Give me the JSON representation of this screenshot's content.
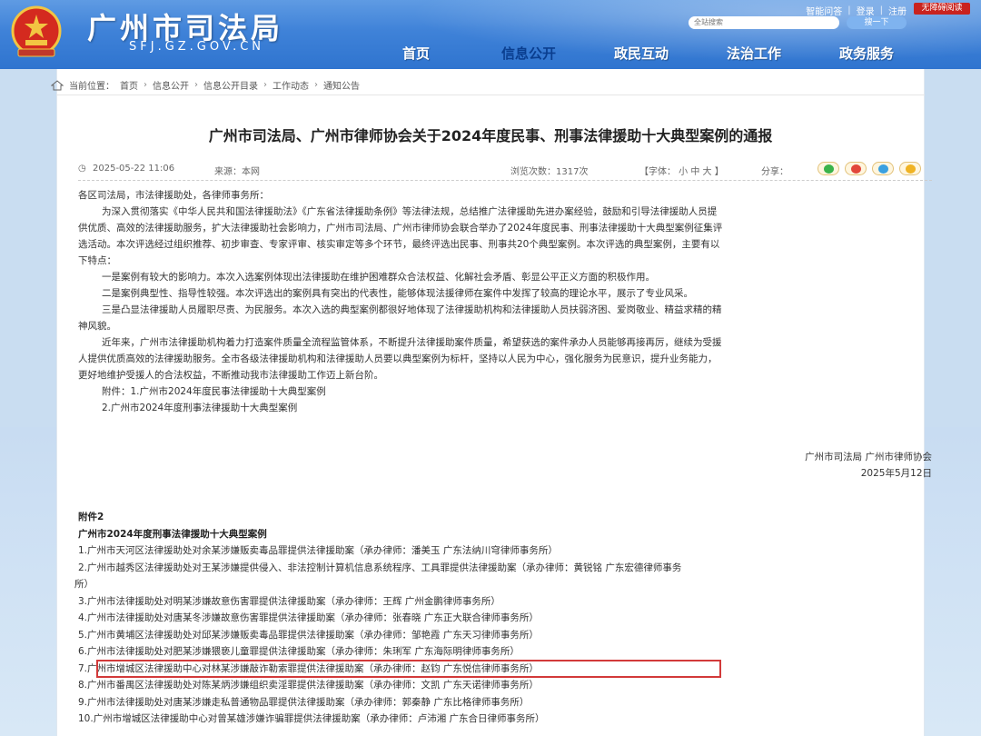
{
  "header": {
    "site_name": "广州市司法局",
    "site_domain": "SFJ.GZ.GOV.CN",
    "toplinks": [
      "智能问答",
      "登录",
      "注册"
    ],
    "a11y_label": "无障碍阅读",
    "search_placeholder": "全站搜索",
    "search_button": "搜一下",
    "nav": [
      "首页",
      "信息公开",
      "政民互动",
      "法治工作",
      "政务服务"
    ]
  },
  "breadcrumb": {
    "label": "当前位置：",
    "items": [
      "首页",
      "信息公开",
      "信息公开目录",
      "工作动态",
      "通知公告"
    ]
  },
  "article": {
    "title": "广州市司法局、广州市律师协会关于2024年度民事、刑事法律援助十大典型案例的通报",
    "date": "2025-05-22 11:06",
    "source": "来源：本网",
    "views": "浏览次数：1317次",
    "font_size": "【字体： 小 中 大 】",
    "share": "分享：",
    "paragraphs": [
      "各区司法局，市法律援助处，各律师事务所：",
      "为深入贯彻落实《中华人民共和国法律援助法》《广东省法律援助条例》等法律法规，总结推广法律援助先进办案经验，鼓励和引导法律援助人员提",
      "供优质、高效的法律援助服务，扩大法律援助社会影响力，广州市司法局、广州市律师协会联合举办了2024年度民事、刑事法律援助十大典型案例征集评",
      "选活动。本次评选经过组织推荐、初步审查、专家评审、核实审定等多个环节，最终评选出民事、刑事共20个典型案例。本次评选的典型案例，主要有以",
      "下特点：",
      "一是案例有较大的影响力。本次入选案例体现出法律援助在维护困难群众合法权益、化解社会矛盾、彰显公平正义方面的积极作用。",
      "二是案例典型性、指导性较强。本次评选出的案例具有突出的代表性，能够体现法援律师在案件中发挥了较高的理论水平，展示了专业风采。",
      "三是凸显法律援助人员履职尽责、为民服务。本次入选的典型案例都很好地体现了法律援助机构和法律援助人员扶弱济困、爱岗敬业、精益求精的精",
      "神风貌。",
      "近年来，广州市法律援助机构着力打造案件质量全流程监管体系，不断提升法律援助案件质量，希望获选的案件承办人员能够再接再厉，继续为受援",
      "人提供优质高效的法律援助服务。全市各级法律援助机构和法律援助人员要以典型案例为标杆，坚持以人民为中心，强化服务为民意识，提升业务能力，",
      "更好地维护受援人的合法权益，不断推动我市法律援助工作迈上新台阶。"
    ],
    "attachments": [
      "附件：1.广州市2024年度民事法律援助十大典型案例",
      "2.广州市2024年度刑事法律援助十大典型案例"
    ],
    "signature_org": "广州市司法局 广州市律师协会",
    "signature_date": "2025年5月12日"
  },
  "cases": {
    "attachment_label": "附件2",
    "heading": "广州市2024年度刑事法律援助十大典型案例",
    "items": [
      "1.广州市天河区法律援助处对余某涉嫌贩卖毒品罪提供法律援助案（承办律师：潘美玉  广东法纳川穹律师事务所）",
      "2.广州市越秀区法律援助处对王某涉嫌提供侵入、非法控制计算机信息系统程序、工具罪提供法律援助案（承办律师：黄锐铭  广东宏德律师事务",
      "所）",
      "3.广州市法律援助处对明某涉嫌故意伤害罪提供法律援助案（承办律师：王辉  广州金鹏律师事务所）",
      "4.广州市法律援助处对唐某冬涉嫌故意伤害罪提供法律援助案（承办律师：张春晓  广东正大联合律师事务所）",
      "5.广州市黄埔区法律援助处对邱某涉嫌贩卖毒品罪提供法律援助案（承办律师：邹艳霞  广东天习律师事务所）",
      "6.广州市法律援助处对肥某涉嫌猥亵儿童罪提供法律援助案（承办律师：朱琍军  广东海际明律师事务所）",
      "7.广州市增城区法律援助中心对林某涉嫌敲诈勒索罪提供法律援助案（承办律师：赵钧  广东悦信律师事务所）",
      "8.广州市番禺区法律援助处对陈某炳涉嫌组织卖淫罪提供法律援助案（承办律师：文凯  广东天诺律师事务所）",
      "9.广州市法律援助处对唐某涉嫌走私普通物品罪提供法律援助案（承办律师：郭秦静  广东比格律师事务所）",
      "10.广州市增城区法律援助中心对曾某雄涉嫌诈骗罪提供法律援助案（承办律师：卢沛湘  广东合日律师事务所）"
    ]
  },
  "colors": {
    "header_blue": "#3f82d8",
    "nav_active": "#0a3e8f",
    "highlight_border": "#d23a3a",
    "a11y_red": "#c9231f"
  }
}
